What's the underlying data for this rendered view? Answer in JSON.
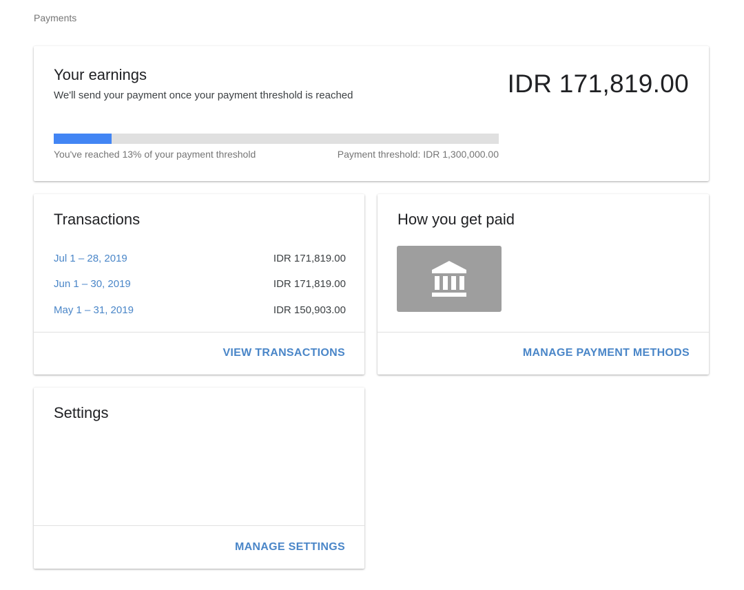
{
  "breadcrumb": "Payments",
  "earnings": {
    "title": "Your earnings",
    "subtitle": "We'll send your payment once your payment threshold is reached",
    "amount": "IDR 171,819.00",
    "progress_fraction": 0.13,
    "progress_text": "You've reached 13% of your payment threshold",
    "threshold_text": "Payment threshold: IDR 1,300,000.00",
    "progress_color": "#4285f4"
  },
  "transactions": {
    "title": "Transactions",
    "rows": [
      {
        "date": "Jul 1 – 28, 2019",
        "amount": "IDR 171,819.00"
      },
      {
        "date": "Jun 1 – 30, 2019",
        "amount": "IDR 171,819.00"
      },
      {
        "date": "May 1 – 31, 2019",
        "amount": "IDR 150,903.00"
      }
    ],
    "action": "VIEW TRANSACTIONS"
  },
  "get_paid": {
    "title": "How you get paid",
    "icon": "bank-icon",
    "action": "MANAGE PAYMENT METHODS"
  },
  "settings": {
    "title": "Settings",
    "action": "MANAGE SETTINGS"
  },
  "colors": {
    "link": "#4a86c8",
    "accent": "#4285f4"
  }
}
